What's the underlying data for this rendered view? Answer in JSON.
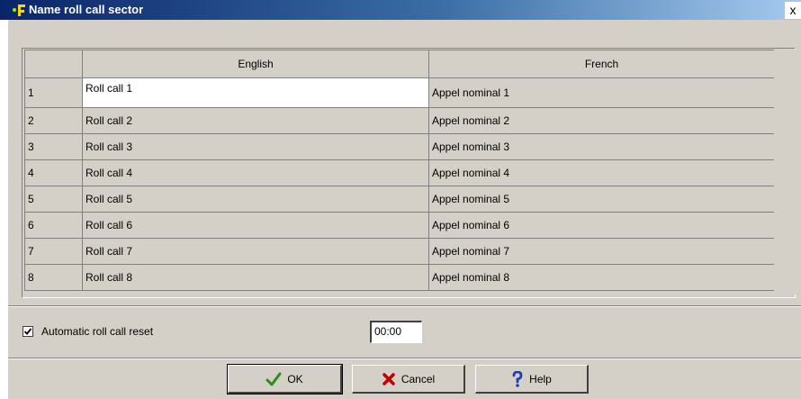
{
  "window": {
    "title": "Name roll call sector",
    "close_label": "x",
    "title_icon": "app-icon"
  },
  "table": {
    "columns": [
      "",
      "English",
      "French"
    ],
    "rows": [
      {
        "num": "1",
        "english": "Roll call 1",
        "french": "Appel nominal 1"
      },
      {
        "num": "2",
        "english": "Roll call 2",
        "french": "Appel nominal 2"
      },
      {
        "num": "3",
        "english": "Roll call 3",
        "french": "Appel nominal 3"
      },
      {
        "num": "4",
        "english": "Roll call 4",
        "french": "Appel nominal 4"
      },
      {
        "num": "5",
        "english": "Roll call 5",
        "french": "Appel nominal 5"
      },
      {
        "num": "6",
        "english": "Roll call 6",
        "french": "Appel nominal 6"
      },
      {
        "num": "7",
        "english": "Roll call 7",
        "french": "Appel nominal 7"
      },
      {
        "num": "8",
        "english": "Roll call 8",
        "french": "Appel nominal 8"
      }
    ]
  },
  "options": {
    "auto_reset_label": "Automatic roll call reset",
    "auto_reset_checked": true,
    "reset_time": "00:00"
  },
  "buttons": {
    "ok": "OK",
    "cancel": "Cancel",
    "help": "Help"
  },
  "colors": {
    "ok_icon": "#2e8b1e",
    "cancel_icon": "#c00000",
    "help_icon": "#1a3fb5"
  }
}
